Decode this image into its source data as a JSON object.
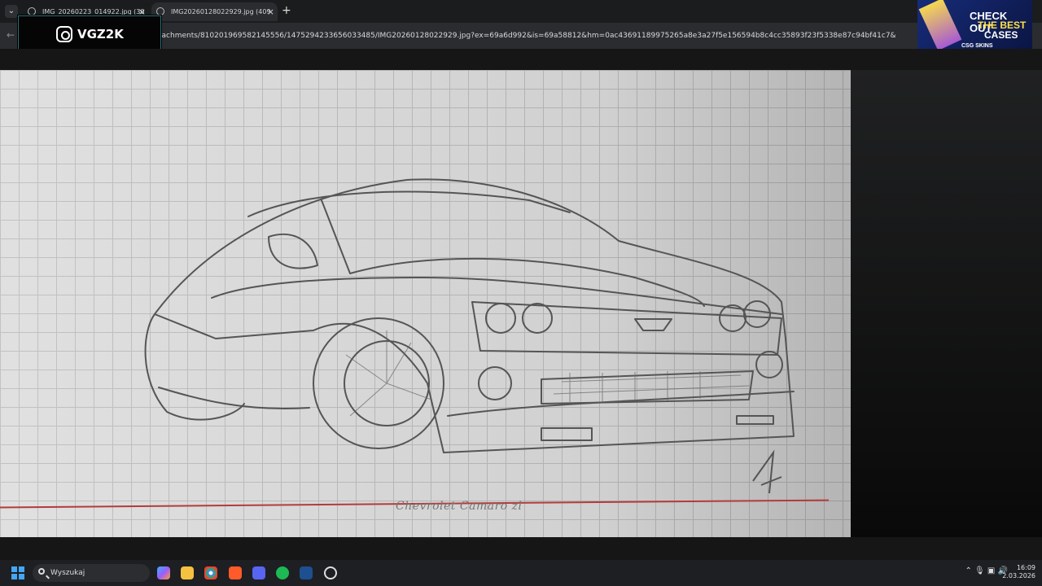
{
  "tabs": [
    {
      "title": "IMG_20260223_014922.jpg (30"
    },
    {
      "title": "IMG20260128022929.jpg (409"
    }
  ],
  "address": {
    "url": "tachments/810201969582145556/1475294233656033485/IMG20260128022929.jpg?ex=69a6d992&is=69a58812&hm=0ac43691189975265a8e3a27f5e156594b8c4cc35893f23f5338e87c94bf41c7&"
  },
  "overlay": {
    "handle": "VGZ2K"
  },
  "ad": {
    "line1": "CHECK OUT",
    "line2": "THE BEST",
    "line3": "CASES",
    "brand": "CSG SKINS"
  },
  "image": {
    "caption": "Chevrolet Camaro zl"
  },
  "taskbar": {
    "search_label": "Wyszukaj",
    "time": "16:09",
    "date": "2.03.2026"
  },
  "colors": {
    "chrome": "#202124",
    "paper": "#dcdcdc",
    "taskbar": "#1e1f22",
    "accent": "#41b9c9"
  }
}
